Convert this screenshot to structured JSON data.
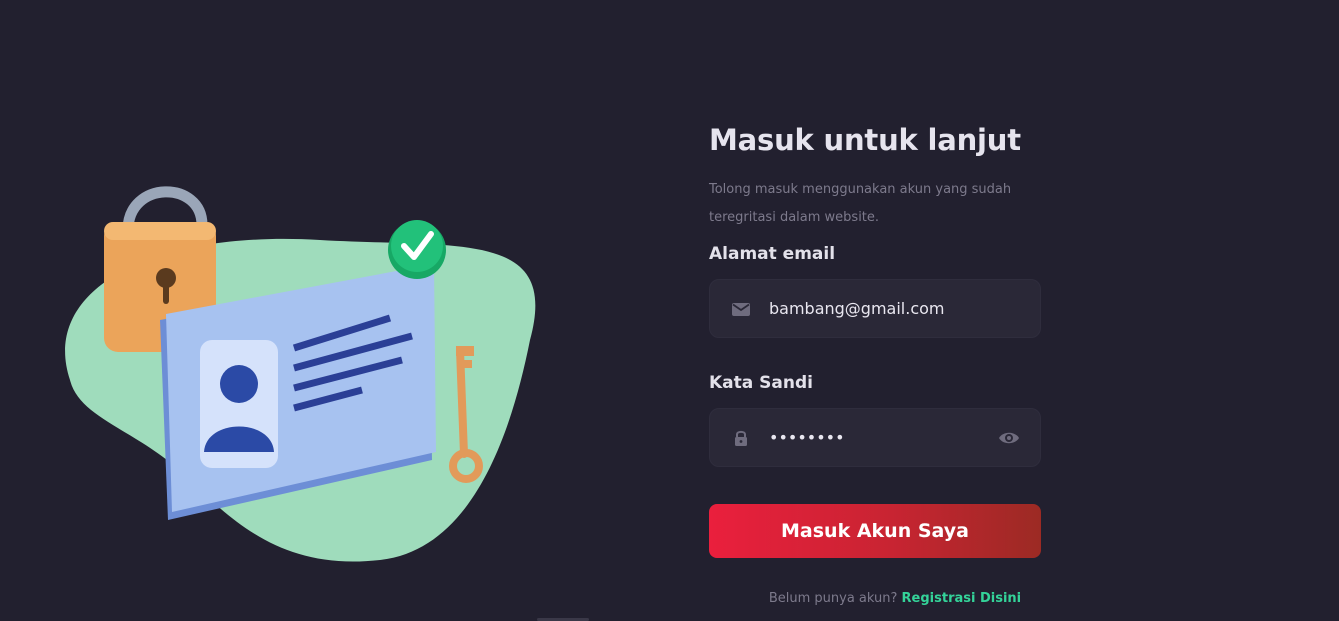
{
  "illustration": {
    "icons": [
      "padlock-icon",
      "id-card-icon",
      "check-badge-icon",
      "key-icon"
    ],
    "colors": {
      "blob": "#9fdcbc",
      "card": "#9bb8ec",
      "padlock": "#eba45a",
      "check": "#22c17a",
      "key": "#e29a5a"
    }
  },
  "login": {
    "title": "Masuk untuk lanjut",
    "subtitle": "Tolong masuk menggunakan akun yang sudah teregritasi dalam website.",
    "email_label": "Alamat email",
    "email_value": "bambang@gmail.com",
    "email_icon": "mail-icon",
    "password_label": "Kata Sandi",
    "password_value": "password",
    "password_icon": "lock-icon",
    "toggle_icon": "eye-icon",
    "submit_label": "Masuk Akun Saya",
    "register_prompt": "Belum punya akun?",
    "register_link": "Registrasi Disini"
  },
  "colors": {
    "background": "#22202f",
    "input_bg": "#2a2837",
    "accent_red": "#ea1f3d",
    "accent_green": "#34d399"
  }
}
